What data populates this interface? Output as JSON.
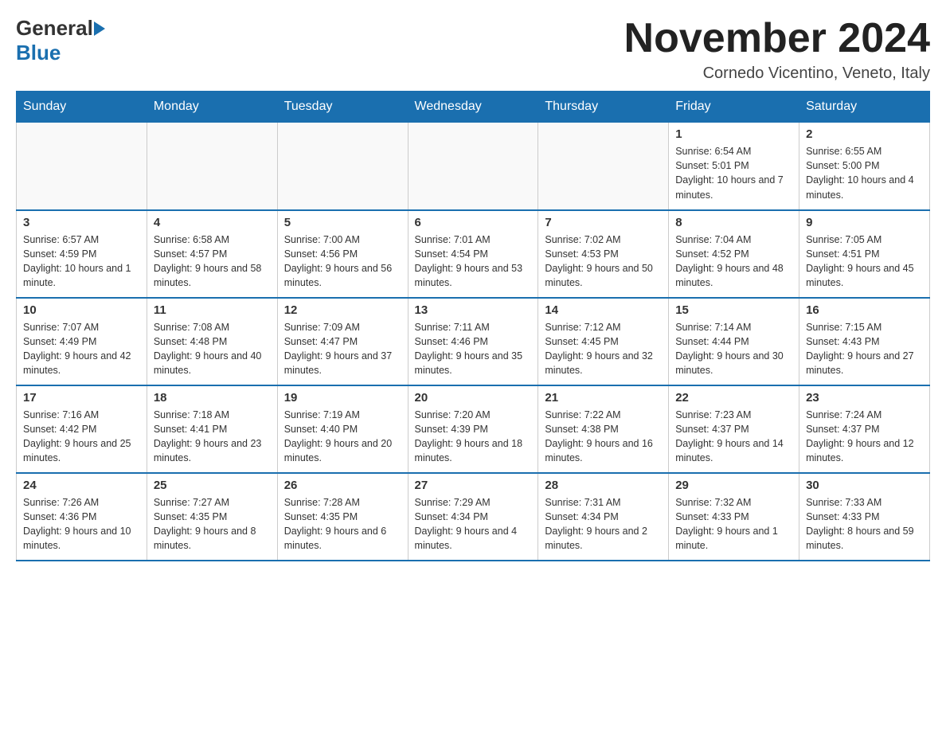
{
  "logo": {
    "general": "General",
    "blue": "Blue"
  },
  "title": "November 2024",
  "location": "Cornedo Vicentino, Veneto, Italy",
  "weekdays": [
    "Sunday",
    "Monday",
    "Tuesday",
    "Wednesday",
    "Thursday",
    "Friday",
    "Saturday"
  ],
  "weeks": [
    [
      {
        "day": "",
        "info": ""
      },
      {
        "day": "",
        "info": ""
      },
      {
        "day": "",
        "info": ""
      },
      {
        "day": "",
        "info": ""
      },
      {
        "day": "",
        "info": ""
      },
      {
        "day": "1",
        "info": "Sunrise: 6:54 AM\nSunset: 5:01 PM\nDaylight: 10 hours and 7 minutes."
      },
      {
        "day": "2",
        "info": "Sunrise: 6:55 AM\nSunset: 5:00 PM\nDaylight: 10 hours and 4 minutes."
      }
    ],
    [
      {
        "day": "3",
        "info": "Sunrise: 6:57 AM\nSunset: 4:59 PM\nDaylight: 10 hours and 1 minute."
      },
      {
        "day": "4",
        "info": "Sunrise: 6:58 AM\nSunset: 4:57 PM\nDaylight: 9 hours and 58 minutes."
      },
      {
        "day": "5",
        "info": "Sunrise: 7:00 AM\nSunset: 4:56 PM\nDaylight: 9 hours and 56 minutes."
      },
      {
        "day": "6",
        "info": "Sunrise: 7:01 AM\nSunset: 4:54 PM\nDaylight: 9 hours and 53 minutes."
      },
      {
        "day": "7",
        "info": "Sunrise: 7:02 AM\nSunset: 4:53 PM\nDaylight: 9 hours and 50 minutes."
      },
      {
        "day": "8",
        "info": "Sunrise: 7:04 AM\nSunset: 4:52 PM\nDaylight: 9 hours and 48 minutes."
      },
      {
        "day": "9",
        "info": "Sunrise: 7:05 AM\nSunset: 4:51 PM\nDaylight: 9 hours and 45 minutes."
      }
    ],
    [
      {
        "day": "10",
        "info": "Sunrise: 7:07 AM\nSunset: 4:49 PM\nDaylight: 9 hours and 42 minutes."
      },
      {
        "day": "11",
        "info": "Sunrise: 7:08 AM\nSunset: 4:48 PM\nDaylight: 9 hours and 40 minutes."
      },
      {
        "day": "12",
        "info": "Sunrise: 7:09 AM\nSunset: 4:47 PM\nDaylight: 9 hours and 37 minutes."
      },
      {
        "day": "13",
        "info": "Sunrise: 7:11 AM\nSunset: 4:46 PM\nDaylight: 9 hours and 35 minutes."
      },
      {
        "day": "14",
        "info": "Sunrise: 7:12 AM\nSunset: 4:45 PM\nDaylight: 9 hours and 32 minutes."
      },
      {
        "day": "15",
        "info": "Sunrise: 7:14 AM\nSunset: 4:44 PM\nDaylight: 9 hours and 30 minutes."
      },
      {
        "day": "16",
        "info": "Sunrise: 7:15 AM\nSunset: 4:43 PM\nDaylight: 9 hours and 27 minutes."
      }
    ],
    [
      {
        "day": "17",
        "info": "Sunrise: 7:16 AM\nSunset: 4:42 PM\nDaylight: 9 hours and 25 minutes."
      },
      {
        "day": "18",
        "info": "Sunrise: 7:18 AM\nSunset: 4:41 PM\nDaylight: 9 hours and 23 minutes."
      },
      {
        "day": "19",
        "info": "Sunrise: 7:19 AM\nSunset: 4:40 PM\nDaylight: 9 hours and 20 minutes."
      },
      {
        "day": "20",
        "info": "Sunrise: 7:20 AM\nSunset: 4:39 PM\nDaylight: 9 hours and 18 minutes."
      },
      {
        "day": "21",
        "info": "Sunrise: 7:22 AM\nSunset: 4:38 PM\nDaylight: 9 hours and 16 minutes."
      },
      {
        "day": "22",
        "info": "Sunrise: 7:23 AM\nSunset: 4:37 PM\nDaylight: 9 hours and 14 minutes."
      },
      {
        "day": "23",
        "info": "Sunrise: 7:24 AM\nSunset: 4:37 PM\nDaylight: 9 hours and 12 minutes."
      }
    ],
    [
      {
        "day": "24",
        "info": "Sunrise: 7:26 AM\nSunset: 4:36 PM\nDaylight: 9 hours and 10 minutes."
      },
      {
        "day": "25",
        "info": "Sunrise: 7:27 AM\nSunset: 4:35 PM\nDaylight: 9 hours and 8 minutes."
      },
      {
        "day": "26",
        "info": "Sunrise: 7:28 AM\nSunset: 4:35 PM\nDaylight: 9 hours and 6 minutes."
      },
      {
        "day": "27",
        "info": "Sunrise: 7:29 AM\nSunset: 4:34 PM\nDaylight: 9 hours and 4 minutes."
      },
      {
        "day": "28",
        "info": "Sunrise: 7:31 AM\nSunset: 4:34 PM\nDaylight: 9 hours and 2 minutes."
      },
      {
        "day": "29",
        "info": "Sunrise: 7:32 AM\nSunset: 4:33 PM\nDaylight: 9 hours and 1 minute."
      },
      {
        "day": "30",
        "info": "Sunrise: 7:33 AM\nSunset: 4:33 PM\nDaylight: 8 hours and 59 minutes."
      }
    ]
  ]
}
